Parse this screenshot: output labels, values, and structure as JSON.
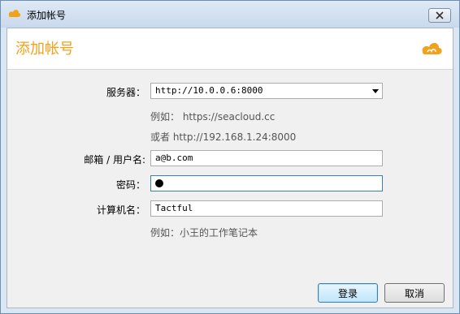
{
  "window": {
    "title": "添加帐号"
  },
  "header": {
    "title": "添加帐号"
  },
  "form": {
    "server_label": "服务器：",
    "server_value": "http://10.0.0.6:8000",
    "server_hint_1": "例如： https://seacloud.cc",
    "server_hint_2": "或者 http://192.168.1.24:8000",
    "email_label": "邮箱 / 用户名:",
    "email_value": "a@b.com",
    "password_label": "密码：",
    "computer_label": "计算机名：",
    "computer_value": "Tactful",
    "computer_hint": "例如：小王的工作笔记本"
  },
  "buttons": {
    "ok_label": "登录",
    "cancel_label": "取消"
  },
  "colors": {
    "accent": "#f0a21b"
  },
  "icons": {
    "app": "seafile-cloud-icon",
    "close": "close-icon"
  }
}
